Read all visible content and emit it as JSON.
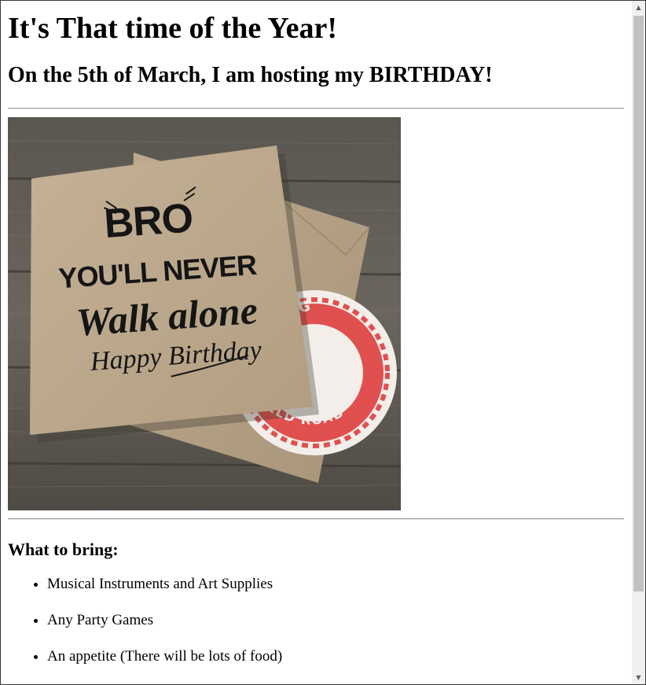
{
  "page": {
    "heading": "It's That time of the Year!",
    "subheading": "On the 5th of March, I am hosting my BIRTHDAY!",
    "image": {
      "line1": "BRO",
      "line2": "YOU'LL NEVER",
      "line3": "Walk alone",
      "line4": "Happy Birthday",
      "coaster_top": "BREWING",
      "coaster_bottom": "ANFIELD ROAD"
    },
    "bring_heading": "What to bring:",
    "bring_items": [
      "Musical Instruments and Art Supplies",
      "Any Party Games",
      "An appetite (There will be lots of food)"
    ]
  },
  "scrollbar": {
    "up_arrow": "▲",
    "down_arrow": "▼"
  }
}
